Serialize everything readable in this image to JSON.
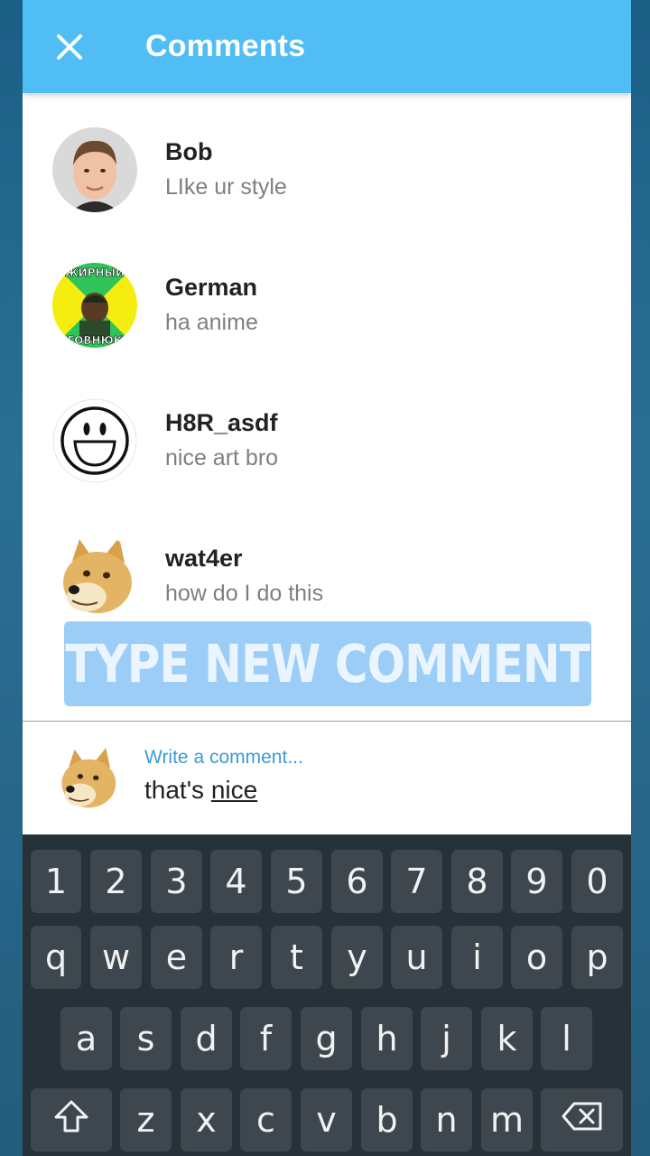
{
  "app_bar": {
    "title": "Comments",
    "close_icon": "close-icon"
  },
  "comments": [
    {
      "name": "Bob",
      "text": "LIke ur style"
    },
    {
      "name": "German",
      "text": "ha anime"
    },
    {
      "name": "H8R_asdf",
      "text": "nice art bro"
    },
    {
      "name": "wat4er",
      "text": "how do I do this"
    }
  ],
  "avatar_meme_text": {
    "top": "ЖИРНЫЙ",
    "bottom": "ГОВНЮК"
  },
  "banner": {
    "text": "TYPE NEW COMMENT"
  },
  "composer": {
    "placeholder": "Write a comment...",
    "value_prefix": "that's ",
    "value_word": "nice"
  },
  "keyboard": {
    "row_numbers": [
      "1",
      "2",
      "3",
      "4",
      "5",
      "6",
      "7",
      "8",
      "9",
      "0"
    ],
    "row_top": [
      "q",
      "w",
      "e",
      "r",
      "t",
      "y",
      "u",
      "i",
      "o",
      "p"
    ],
    "row_mid": [
      "a",
      "s",
      "d",
      "f",
      "g",
      "h",
      "j",
      "k",
      "l"
    ],
    "row_bottom": [
      "z",
      "x",
      "c",
      "v",
      "b",
      "n",
      "m"
    ],
    "shift_icon": "shift-icon",
    "backspace_icon": "backspace-icon"
  },
  "colors": {
    "app_bar": "#50bdf4",
    "banner": "#9ccdf7",
    "hint": "#3a9bd5",
    "keyboard": "#263238",
    "key": "#3d474d"
  }
}
